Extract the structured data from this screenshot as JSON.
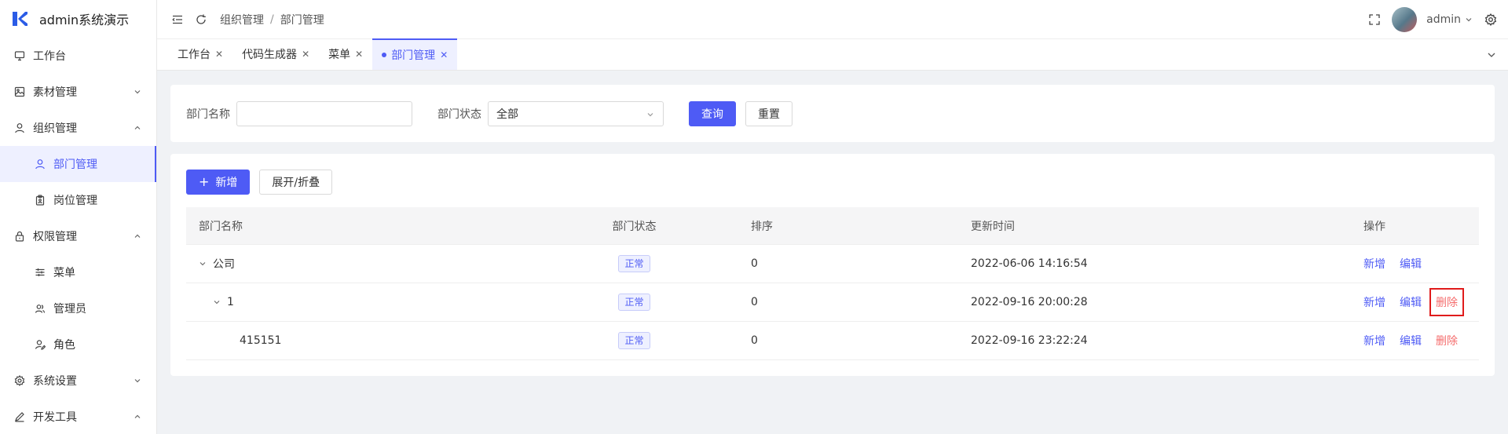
{
  "app": {
    "title": "admin系统演示"
  },
  "sidebar": {
    "items": [
      {
        "label": "工作台",
        "icon": "monitor-icon"
      },
      {
        "label": "素材管理",
        "icon": "image-icon",
        "state": "collapsed"
      },
      {
        "label": "组织管理",
        "icon": "user-icon",
        "state": "expanded",
        "children": [
          {
            "label": "部门管理",
            "icon": "user-icon",
            "active": true
          },
          {
            "label": "岗位管理",
            "icon": "clipboard-icon"
          }
        ]
      },
      {
        "label": "权限管理",
        "icon": "lock-icon",
        "state": "expanded",
        "children": [
          {
            "label": "菜单",
            "icon": "sliders-icon"
          },
          {
            "label": "管理员",
            "icon": "users-icon"
          },
          {
            "label": "角色",
            "icon": "user-edit-icon"
          }
        ]
      },
      {
        "label": "系统设置",
        "icon": "gear-icon",
        "state": "collapsed"
      },
      {
        "label": "开发工具",
        "icon": "pen-icon",
        "state": "expanded"
      }
    ]
  },
  "header": {
    "breadcrumb": [
      "组织管理",
      "部门管理"
    ],
    "separator": "/",
    "username": "admin"
  },
  "tabs": [
    {
      "label": "工作台",
      "active": false
    },
    {
      "label": "代码生成器",
      "active": false
    },
    {
      "label": "菜单",
      "active": false
    },
    {
      "label": "部门管理",
      "active": true
    }
  ],
  "search": {
    "name_label": "部门名称",
    "name_value": "",
    "status_label": "部门状态",
    "status_value": "全部",
    "query_button": "查询",
    "reset_button": "重置"
  },
  "toolbar": {
    "add_button": "新增",
    "expand_button": "展开/折叠"
  },
  "table": {
    "columns": [
      "部门名称",
      "部门状态",
      "排序",
      "更新时间",
      "操作"
    ],
    "rows": [
      {
        "name": "公司",
        "status": "正常",
        "sort": "0",
        "updated": "2022-06-06 14:16:54",
        "level": 0,
        "expanded": true,
        "ops": [
          "新增",
          "编辑"
        ]
      },
      {
        "name": "1",
        "status": "正常",
        "sort": "0",
        "updated": "2022-09-16 20:00:28",
        "level": 1,
        "expanded": true,
        "ops": [
          "新增",
          "编辑",
          "删除"
        ]
      },
      {
        "name": "415151",
        "status": "正常",
        "sort": "0",
        "updated": "2022-09-16 23:22:24",
        "level": 2,
        "expanded": false,
        "ops": [
          "新增",
          "编辑",
          "删除"
        ]
      }
    ]
  },
  "colors": {
    "primary": "#4e5bf5",
    "danger": "#f56c6c",
    "highlight_box": "#e01b1b",
    "page_bg": "#f0f2f5"
  }
}
